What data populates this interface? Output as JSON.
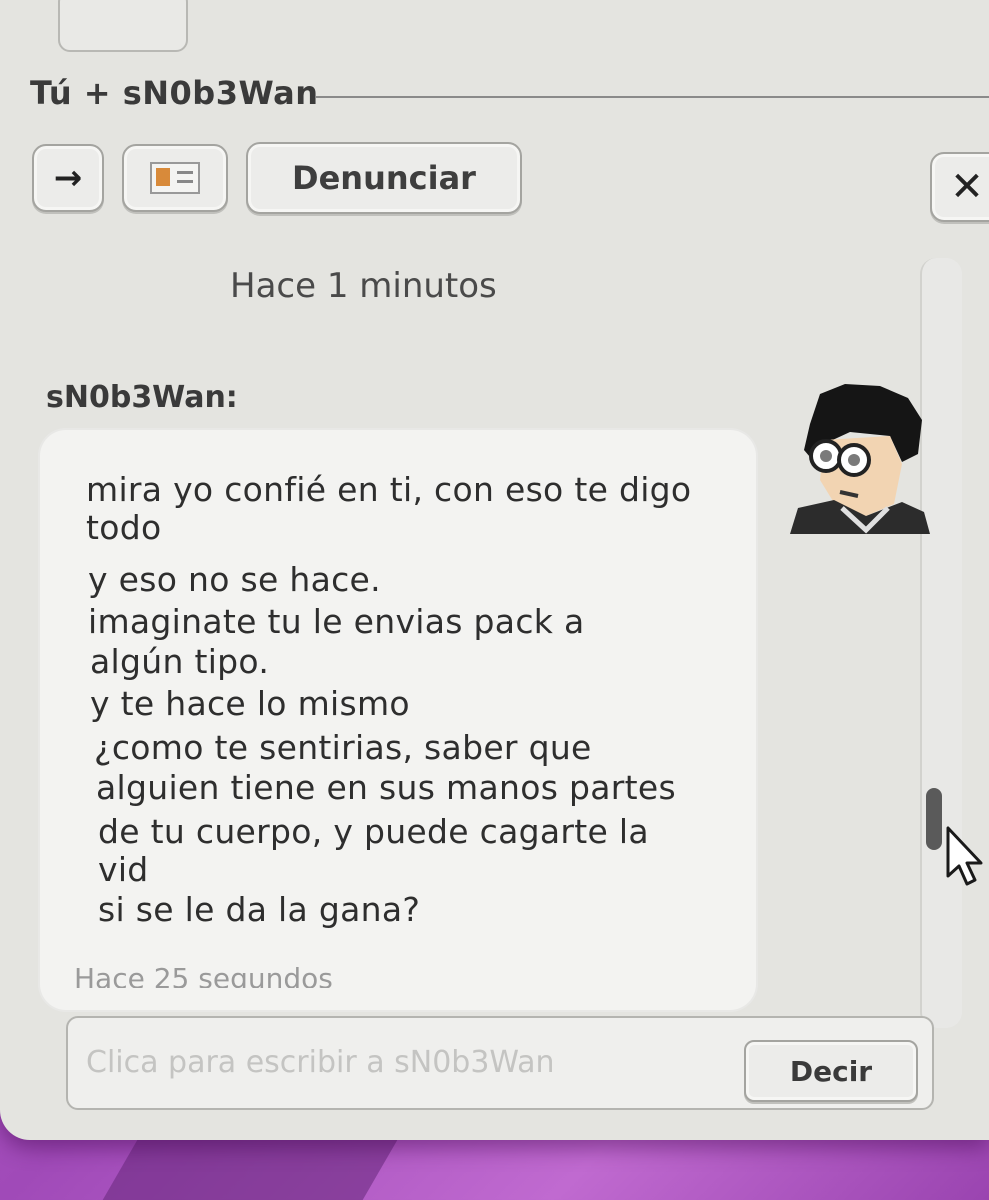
{
  "window": {
    "title": "Tú + sN0b3Wan"
  },
  "toolbar": {
    "arrow_icon": "→",
    "report_label": "Denunciar",
    "close_icon": "✕"
  },
  "chat": {
    "timestamp_top": "Hace 1 minutos",
    "sender": "sN0b3Wan:",
    "message_lines": [
      "mira yo confié en ti, con eso te digo",
      "todo",
      "y eso no se hace.",
      "imaginate tu le envias pack a",
      "algún tipo.",
      "y te hace lo mismo",
      "¿como te sentirias, saber que",
      "alguien tiene en sus manos partes",
      "de tu cuerpo, y puede cagarte la",
      "vid",
      "si se le da la gana?"
    ],
    "message_time": "Hace 25 segundos"
  },
  "composer": {
    "placeholder": "Clica para escribir a sN0b3Wan",
    "value": "",
    "send_label": "Decir"
  },
  "colors": {
    "desktop_bg": "#a04ab8",
    "window_bg": "#e4e4e0",
    "bubble_bg": "#f3f3f1",
    "text": "#2e2e2e"
  },
  "icons": [
    "arrow-right-icon",
    "user-card-icon",
    "close-icon",
    "avatar",
    "mouse-cursor-icon"
  ]
}
